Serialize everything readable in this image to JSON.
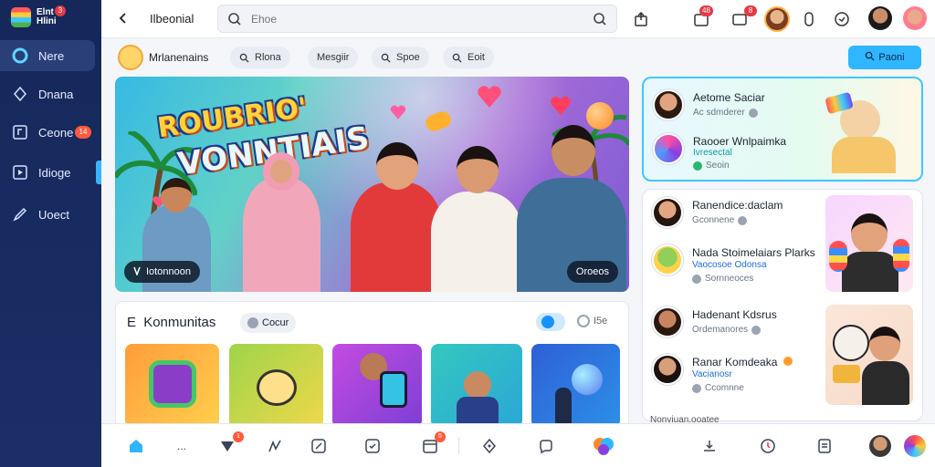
{
  "app": {
    "logo_text": "Elnt Hlini",
    "logo_badge": "3"
  },
  "sidebar": {
    "items": [
      {
        "label": "Nere",
        "icon": "home-icon",
        "active": true
      },
      {
        "label": "Dnana",
        "icon": "compass-icon"
      },
      {
        "label": "Ceone",
        "icon": "music-icon",
        "badge": "14"
      },
      {
        "label": "Idioge",
        "icon": "video-icon"
      },
      {
        "label": "Uoect",
        "icon": "edit-icon"
      }
    ]
  },
  "topbar": {
    "title": "Ilbeonial",
    "search_placeholder": "Ehoe",
    "badges": [
      "48",
      "8"
    ]
  },
  "filterbar": {
    "channel_name": "Mrlanenains",
    "chips": [
      {
        "label": "Rlona",
        "icon": "search-icon"
      },
      {
        "label": "Mesgiir",
        "icon": ""
      },
      {
        "label": "Spoe",
        "icon": "search-icon"
      },
      {
        "label": "Eoit",
        "icon": "search-icon"
      }
    ],
    "primary_button": "Paoni"
  },
  "hero": {
    "title_line1": "ROUBRIO'",
    "title_line2": "VONNTIAIS",
    "tag_left": "Iotonnoon",
    "tag_right": "Oroeos"
  },
  "community": {
    "title": "Konmunitas",
    "title_prefix": "E",
    "chip_label": "Cocur",
    "misc_label": "I5e"
  },
  "right_panel": {
    "featured": [
      {
        "name": "Aetome Saciar",
        "sub": "Ac sdmderer",
        "sub_style": "muted"
      },
      {
        "name": "Raooer Wnlpaimka",
        "sub": "Ivresectal",
        "sub2": "Seoin",
        "sub_style": "accent"
      }
    ],
    "list": [
      {
        "name": "Ranendice:daclam",
        "sub": "Gconnene"
      },
      {
        "name": "Nada Stoimelaiars Plarks",
        "sub": "Vaocosoe Odonsa",
        "sub2": "Sornneoces",
        "sub_style": "accent"
      },
      {
        "name": "Hadenant Kdsrus",
        "sub": "Ordemanores"
      },
      {
        "name": "Ranar Komdeaka",
        "sub": "Vacianosr",
        "sub2": "Ccomnne",
        "sub_style": "accent"
      }
    ],
    "footer": "Nonviuan.ooatee"
  },
  "bottombar": {
    "badges": [
      "1",
      "5"
    ],
    "more_label": "..."
  },
  "colors": {
    "sidebar_bg": "#16285a",
    "accent": "#2fb6ff",
    "badge": "#e63946"
  }
}
